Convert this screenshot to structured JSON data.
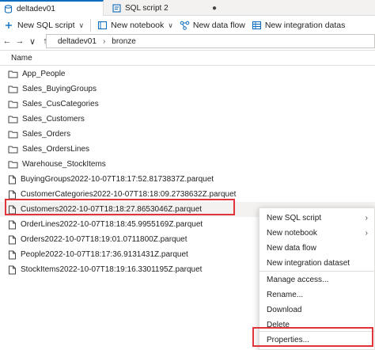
{
  "tabs": [
    {
      "label": "deltadev01",
      "icon": "database-icon",
      "active": true
    },
    {
      "label": "SQL script 2",
      "icon": "sql-script-icon",
      "active": false,
      "dirty_marker": "●"
    }
  ],
  "toolbar": {
    "new_sql_script": "New SQL script",
    "new_notebook": "New notebook",
    "new_data_flow": "New data flow",
    "new_integration_dataset": "New integration datas"
  },
  "nav": {
    "back": "←",
    "forward": "→",
    "down": "∨",
    "up": "↑",
    "crumbs": [
      "deltadev01",
      "bronze"
    ],
    "crumb_separator": "›"
  },
  "list": {
    "header": "Name",
    "folders": [
      "App_People",
      "Sales_BuyingGroups",
      "Sales_CusCategories",
      "Sales_Customers",
      "Sales_Orders",
      "Sales_OrdersLines",
      "Warehouse_StockItems"
    ],
    "files": [
      "BuyingGroups2022-10-07T18:17:52.8173837Z.parquet",
      "CustomerCategories2022-10-07T18:18:09.2738632Z.parquet",
      "Customers2022-10-07T18:18:27.8653046Z.parquet",
      "OrderLines2022-10-07T18:18:45.9955169Z.parquet",
      "Orders2022-10-07T18:19:01.0711800Z.parquet",
      "People2022-10-07T18:17:36.9131431Z.parquet",
      "StockItems2022-10-07T18:19:16.3301195Z.parquet"
    ],
    "selected_file": "Customers2022-10-07T18:18:27.8653046Z.parquet"
  },
  "context_menu": {
    "items": [
      {
        "label": "New SQL script",
        "submenu": true
      },
      {
        "label": "New notebook",
        "submenu": true
      },
      {
        "label": "New data flow",
        "submenu": false
      },
      {
        "label": "New integration dataset",
        "submenu": false
      },
      {
        "label": "Manage access...",
        "submenu": false
      },
      {
        "label": "Rename...",
        "submenu": false
      },
      {
        "label": "Download",
        "submenu": false
      },
      {
        "label": "Delete",
        "submenu": false
      },
      {
        "label": "Properties...",
        "submenu": false
      }
    ],
    "submenu_arrow": "›"
  },
  "colors": {
    "accent": "#0f6cbd",
    "highlight": "#e0343a",
    "selected_row": "#f3f2f1"
  }
}
